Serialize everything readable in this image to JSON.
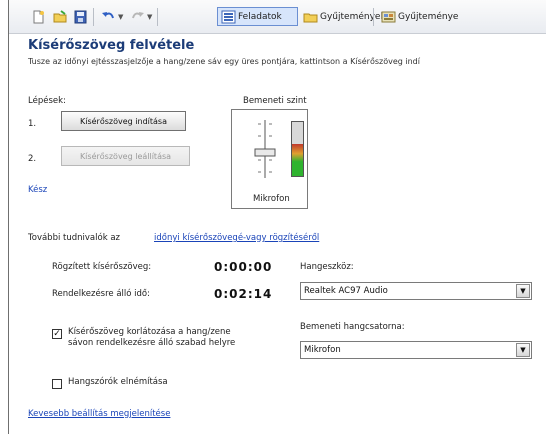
{
  "toolbar": {
    "items": [
      {
        "icon": "new-document-icon",
        "label": ""
      },
      {
        "icon": "open-folder-icon",
        "label": ""
      },
      {
        "icon": "save-icon",
        "label": ""
      },
      {
        "icon": "undo-icon",
        "label": ""
      },
      {
        "icon": "redo-icon",
        "label": ""
      }
    ],
    "tasks_label": "Feladatok",
    "collections_label": "Gyűjtemények",
    "collection_view_label": "Gyűjteménye"
  },
  "title": "Kísérőszöveg felvétele",
  "subtitle": "Tusze az időnyi ejtésszasjelzője a hang/zene sáv egy üres pontjára, kattintson a Kísérőszöveg indí",
  "steps_label": "Lépések:",
  "step1": {
    "num": "1.",
    "button": "Kísérőszöveg indítása"
  },
  "step2": {
    "num": "2.",
    "button": "Kísérőszöveg leállítása"
  },
  "status_link": "Kész",
  "volume": {
    "label": "Bemeneti szint",
    "mic_label": "Mikrofon",
    "slider_level": 0.45,
    "meter_level": 0.6
  },
  "more_info": {
    "prefix": "További tudnivalók az ",
    "link": "időnyi kísérőszövegé-vagy rögzítéséről"
  },
  "recorded": {
    "label": "Rögzített kísérőszöveg:",
    "value": "0:00:00"
  },
  "available": {
    "label": "Rendelkezésre álló idő:",
    "value": "0:02:14"
  },
  "audio_device": {
    "label": "Hangeszköz:",
    "value": "Realtek AC97 Audio"
  },
  "audio_input": {
    "label": "Bemeneti hangcsatorna:",
    "value": "Mikrofon"
  },
  "options": {
    "limit_label": "Kísérőszöveg korlátozása a hang/zene sávon rendelkezésre álló szabad helyre",
    "limit_checked": true,
    "mute_label": "Hangszórók elnémítása",
    "mute_checked": false
  },
  "fewer_options_link": "Kevesebb beállítás megjelenítése"
}
